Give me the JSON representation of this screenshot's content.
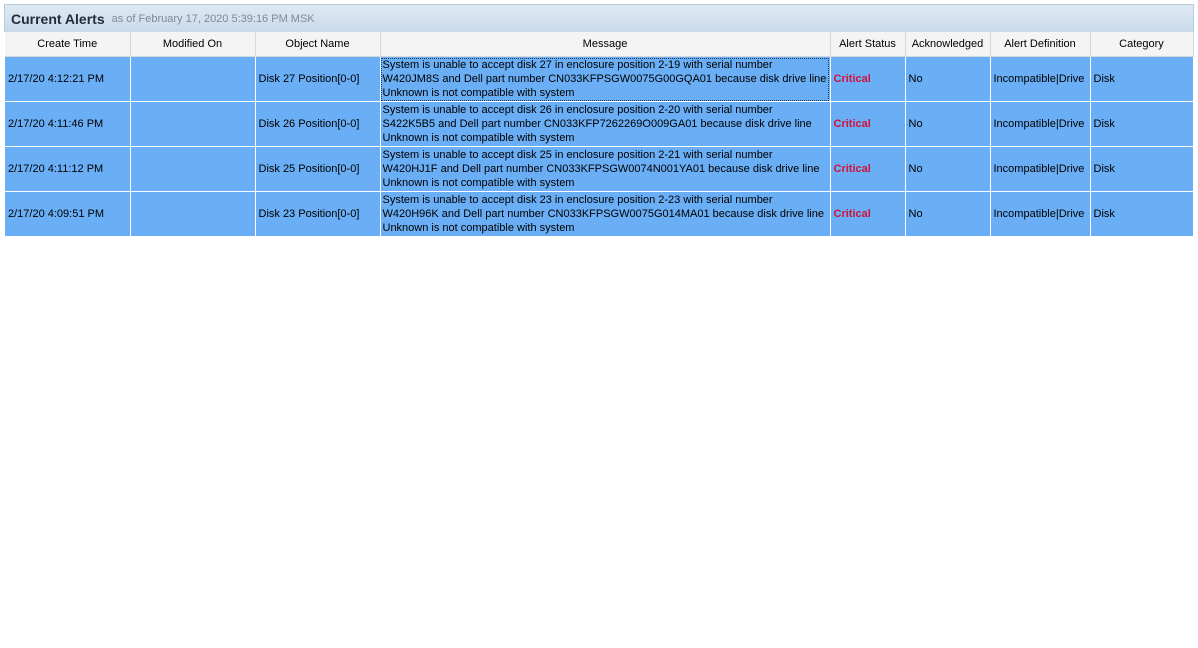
{
  "header": {
    "title": "Current Alerts",
    "as_of": "as of February 17, 2020 5:39:16 PM MSK"
  },
  "columns": [
    "Create Time",
    "Modified On",
    "Object Name",
    "Message",
    "Alert Status",
    "Acknowledged",
    "Alert Definition",
    "Category"
  ],
  "rows": [
    {
      "create_time": "2/17/20 4:12:21 PM",
      "modified_on": "",
      "object_name": "Disk 27 Position[0-0]",
      "message": "System is unable to accept disk 27 in enclosure position 2-19 with serial number W420JM8S and Dell part number CN033KFPSGW0075G00GQA01 because disk drive line Unknown is not compatible with system",
      "alert_status": "Critical",
      "acknowledged": "No",
      "alert_definition": "Incompatible|Drive",
      "category": "Disk"
    },
    {
      "create_time": "2/17/20 4:11:46 PM",
      "modified_on": "",
      "object_name": "Disk 26 Position[0-0]",
      "message": "System is unable to accept disk 26 in enclosure position 2-20 with serial number S422K5B5 and Dell part number CN033KFP7262269O009GA01 because disk drive line Unknown is not compatible with system",
      "alert_status": "Critical",
      "acknowledged": "No",
      "alert_definition": "Incompatible|Drive",
      "category": "Disk"
    },
    {
      "create_time": "2/17/20 4:11:12 PM",
      "modified_on": "",
      "object_name": "Disk 25 Position[0-0]",
      "message": "System is unable to accept disk 25 in enclosure position 2-21 with serial number W420HJ1F and Dell part number CN033KFPSGW0074N001YA01 because disk drive line Unknown is not compatible with system",
      "alert_status": "Critical",
      "acknowledged": "No",
      "alert_definition": "Incompatible|Drive",
      "category": "Disk"
    },
    {
      "create_time": "2/17/20 4:09:51 PM",
      "modified_on": "",
      "object_name": "Disk 23 Position[0-0]",
      "message": "System is unable to accept disk 23 in enclosure position 2-23 with serial number W420H96K and Dell part number CN033KFPSGW0075G014MA01 because disk drive line Unknown is not compatible with system",
      "alert_status": "Critical",
      "acknowledged": "No",
      "alert_definition": "Incompatible|Drive",
      "category": "Disk"
    }
  ],
  "colors": {
    "row_selected_bg": "#6aaef5",
    "critical_text": "#d0143c"
  }
}
